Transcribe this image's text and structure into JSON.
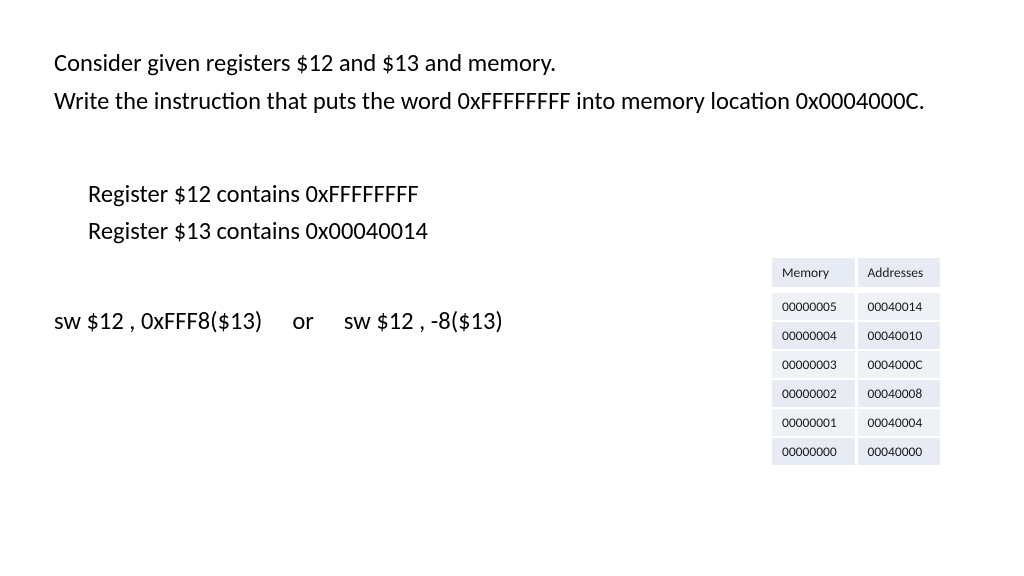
{
  "text": {
    "line1": "Consider given registers $12 and $13 and memory.",
    "line2": "Write the instruction that puts the word 0xFFFFFFFF into memory location 0x0004000C.",
    "reg1": "Register $12 contains 0xFFFFFFFF",
    "reg2": "Register $13 contains 0x00040014",
    "answer": "sw $12 , 0xFFF8($13)  or  sw $12 , -8($13)"
  },
  "table": {
    "headers": {
      "col1": "Memory",
      "col2": "Addresses"
    },
    "rows": [
      {
        "mem": "00000005",
        "addr": "00040014"
      },
      {
        "mem": "00000004",
        "addr": "00040010"
      },
      {
        "mem": "00000003",
        "addr": "0004000C"
      },
      {
        "mem": "00000002",
        "addr": "00040008"
      },
      {
        "mem": "00000001",
        "addr": "00040004"
      },
      {
        "mem": "00000000",
        "addr": "00040000"
      }
    ]
  }
}
